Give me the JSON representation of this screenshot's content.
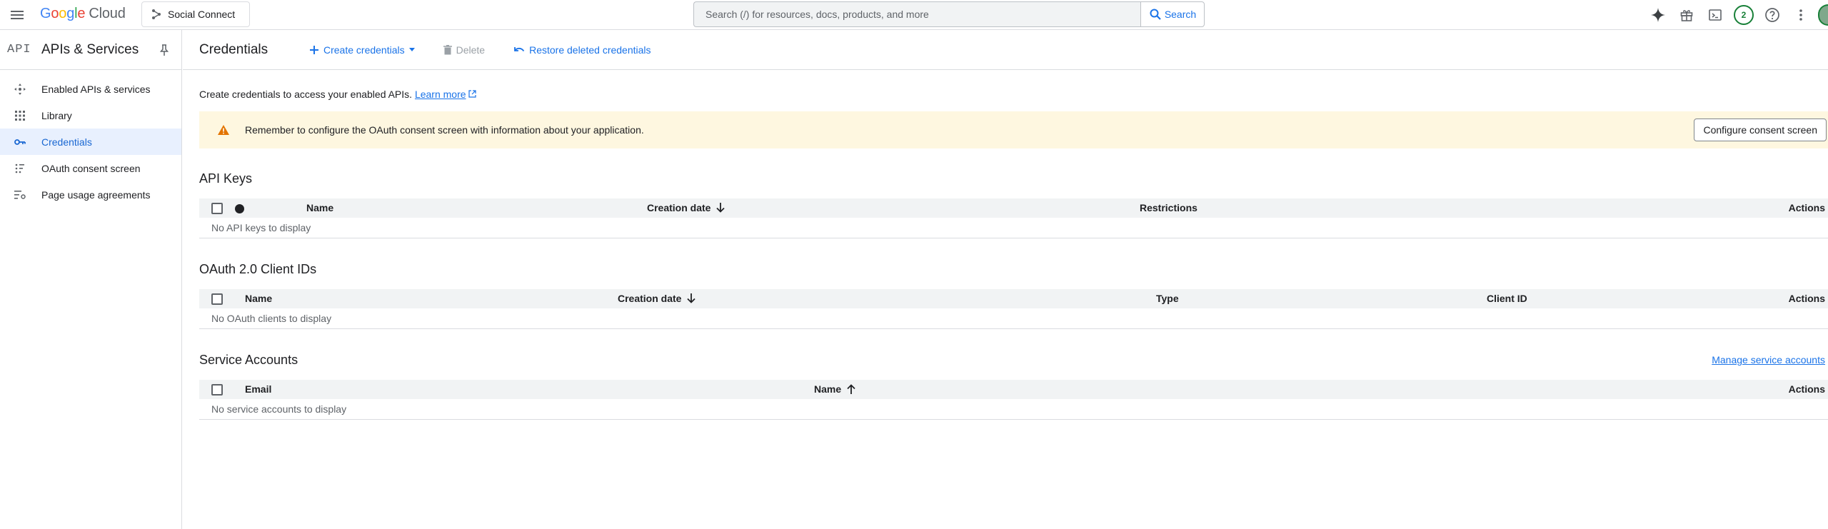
{
  "topbar": {
    "logo_google": [
      "G",
      "o",
      "o",
      "g",
      "l",
      "e"
    ],
    "logo_cloud": "Cloud",
    "project_name": "Social Connect",
    "search_placeholder": "Search (/) for resources, docs, products, and more",
    "search_button": "Search",
    "notification_count": "2"
  },
  "sidebar": {
    "logo": "API",
    "title": "APIs & Services",
    "items": [
      {
        "label": "Enabled APIs & services",
        "icon": "hub-icon"
      },
      {
        "label": "Library",
        "icon": "grid-icon"
      },
      {
        "label": "Credentials",
        "icon": "key-icon",
        "active": true
      },
      {
        "label": "OAuth consent screen",
        "icon": "consent-icon"
      },
      {
        "label": "Page usage agreements",
        "icon": "agreement-icon"
      }
    ]
  },
  "header": {
    "title": "Credentials",
    "create_label": "Create credentials",
    "delete_label": "Delete",
    "restore_label": "Restore deleted credentials"
  },
  "intro": {
    "text": "Create credentials to access your enabled APIs.",
    "link": "Learn more"
  },
  "banner": {
    "text": "Remember to configure the OAuth consent screen with information about your application.",
    "button": "Configure consent screen"
  },
  "api_keys": {
    "title": "API Keys",
    "columns": [
      "Name",
      "Creation date",
      "Restrictions",
      "Actions"
    ],
    "empty": "No API keys to display"
  },
  "oauth": {
    "title": "OAuth 2.0 Client IDs",
    "columns": [
      "Name",
      "Creation date",
      "Type",
      "Client ID",
      "Actions"
    ],
    "empty": "No OAuth clients to display"
  },
  "service_accounts": {
    "title": "Service Accounts",
    "manage_link": "Manage service accounts",
    "columns": [
      "Email",
      "Name",
      "Actions"
    ],
    "empty": "No service accounts to display"
  },
  "colors": {
    "accent": "#1a73e8",
    "banner_bg": "#fef7e0",
    "warning": "#e37400",
    "active_bg": "#e8f0fe"
  }
}
